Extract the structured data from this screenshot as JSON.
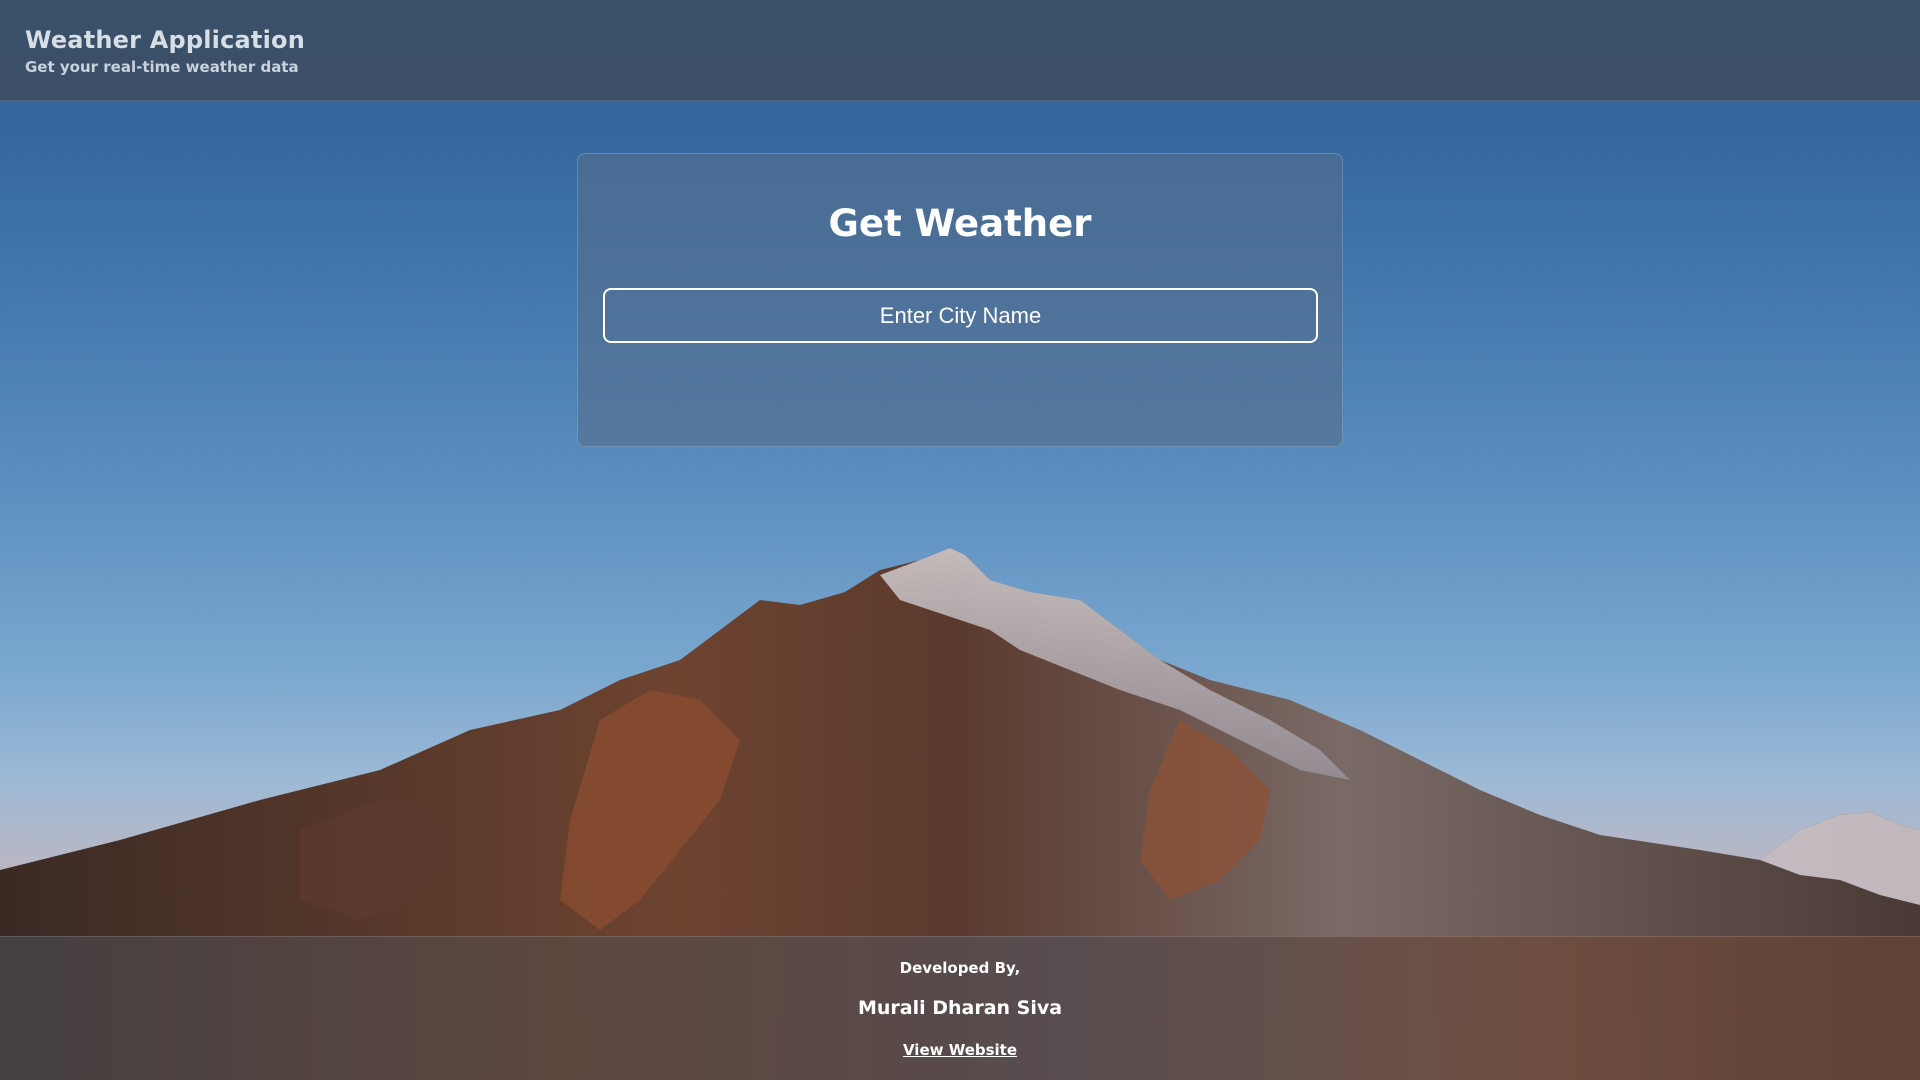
{
  "header": {
    "title": "Weather Application",
    "subtitle": "Get your real-time weather data"
  },
  "card": {
    "heading": "Get Weather",
    "input_placeholder": "Enter City Name",
    "input_value": ""
  },
  "footer": {
    "developed_by": "Developed By,",
    "developer_name": "Murali Dharan Siva",
    "website_link": "View Website"
  },
  "colors": {
    "sky_top": "#2d5c94",
    "sky_bottom": "#9cb9d6",
    "header_bg": "#3c4e64",
    "card_bg": "#546e8c",
    "text": "#ffffff"
  }
}
